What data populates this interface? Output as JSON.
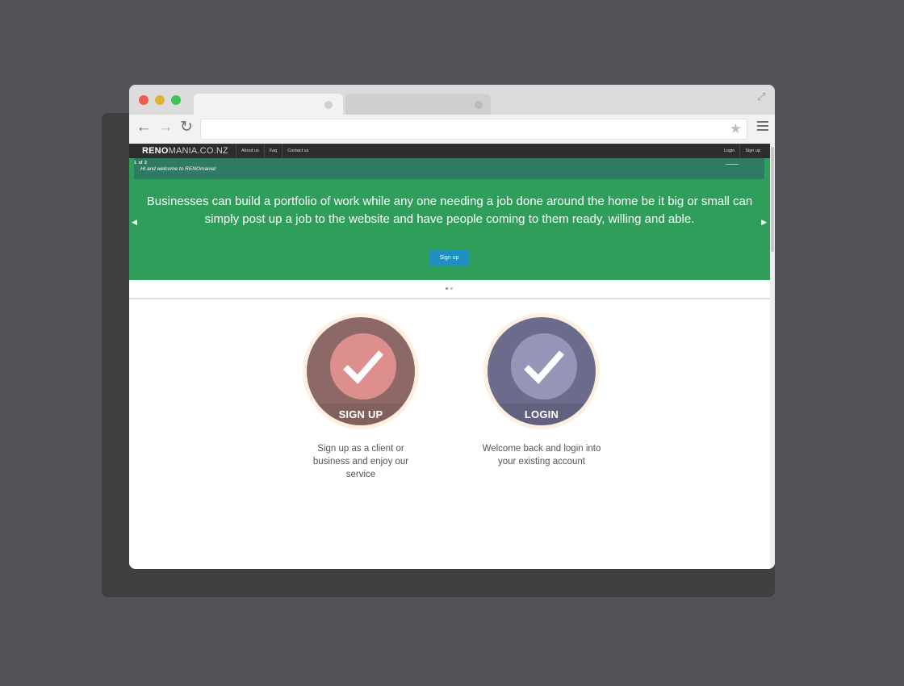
{
  "browser": {
    "url": "",
    "icons": {
      "back": "back-arrow-icon",
      "forward": "forward-arrow-icon",
      "reload": "reload-icon",
      "bookmark": "star-icon",
      "menu": "hamburger-menu-icon",
      "expand": "expand-icon"
    }
  },
  "site": {
    "brand_bold": "RENO",
    "brand_light": "MANIA.CO.NZ",
    "nav_links": [
      "About us",
      "Faq",
      "Contact us"
    ],
    "nav_right": [
      "Login",
      "Sign up"
    ]
  },
  "hero": {
    "counter_current": "1",
    "counter_of": "of",
    "counter_total": "2",
    "welcome": "Hi and welcome to RENOmania!",
    "text": "Businesses can build a portfolio of work while any one needing a job done around the home be it big or small can simply post up a job to the website and have people coming to them ready, willing and able.",
    "button": "Sign up",
    "color": "#2f9e5b"
  },
  "cards": {
    "signup": {
      "label": "SIGN UP",
      "description": "Sign up as a client or business and enjoy our service",
      "color": "#8c6967"
    },
    "login": {
      "label": "LOGIN",
      "description": "Welcome back and login into your existing account",
      "color": "#6b6b8b"
    }
  }
}
